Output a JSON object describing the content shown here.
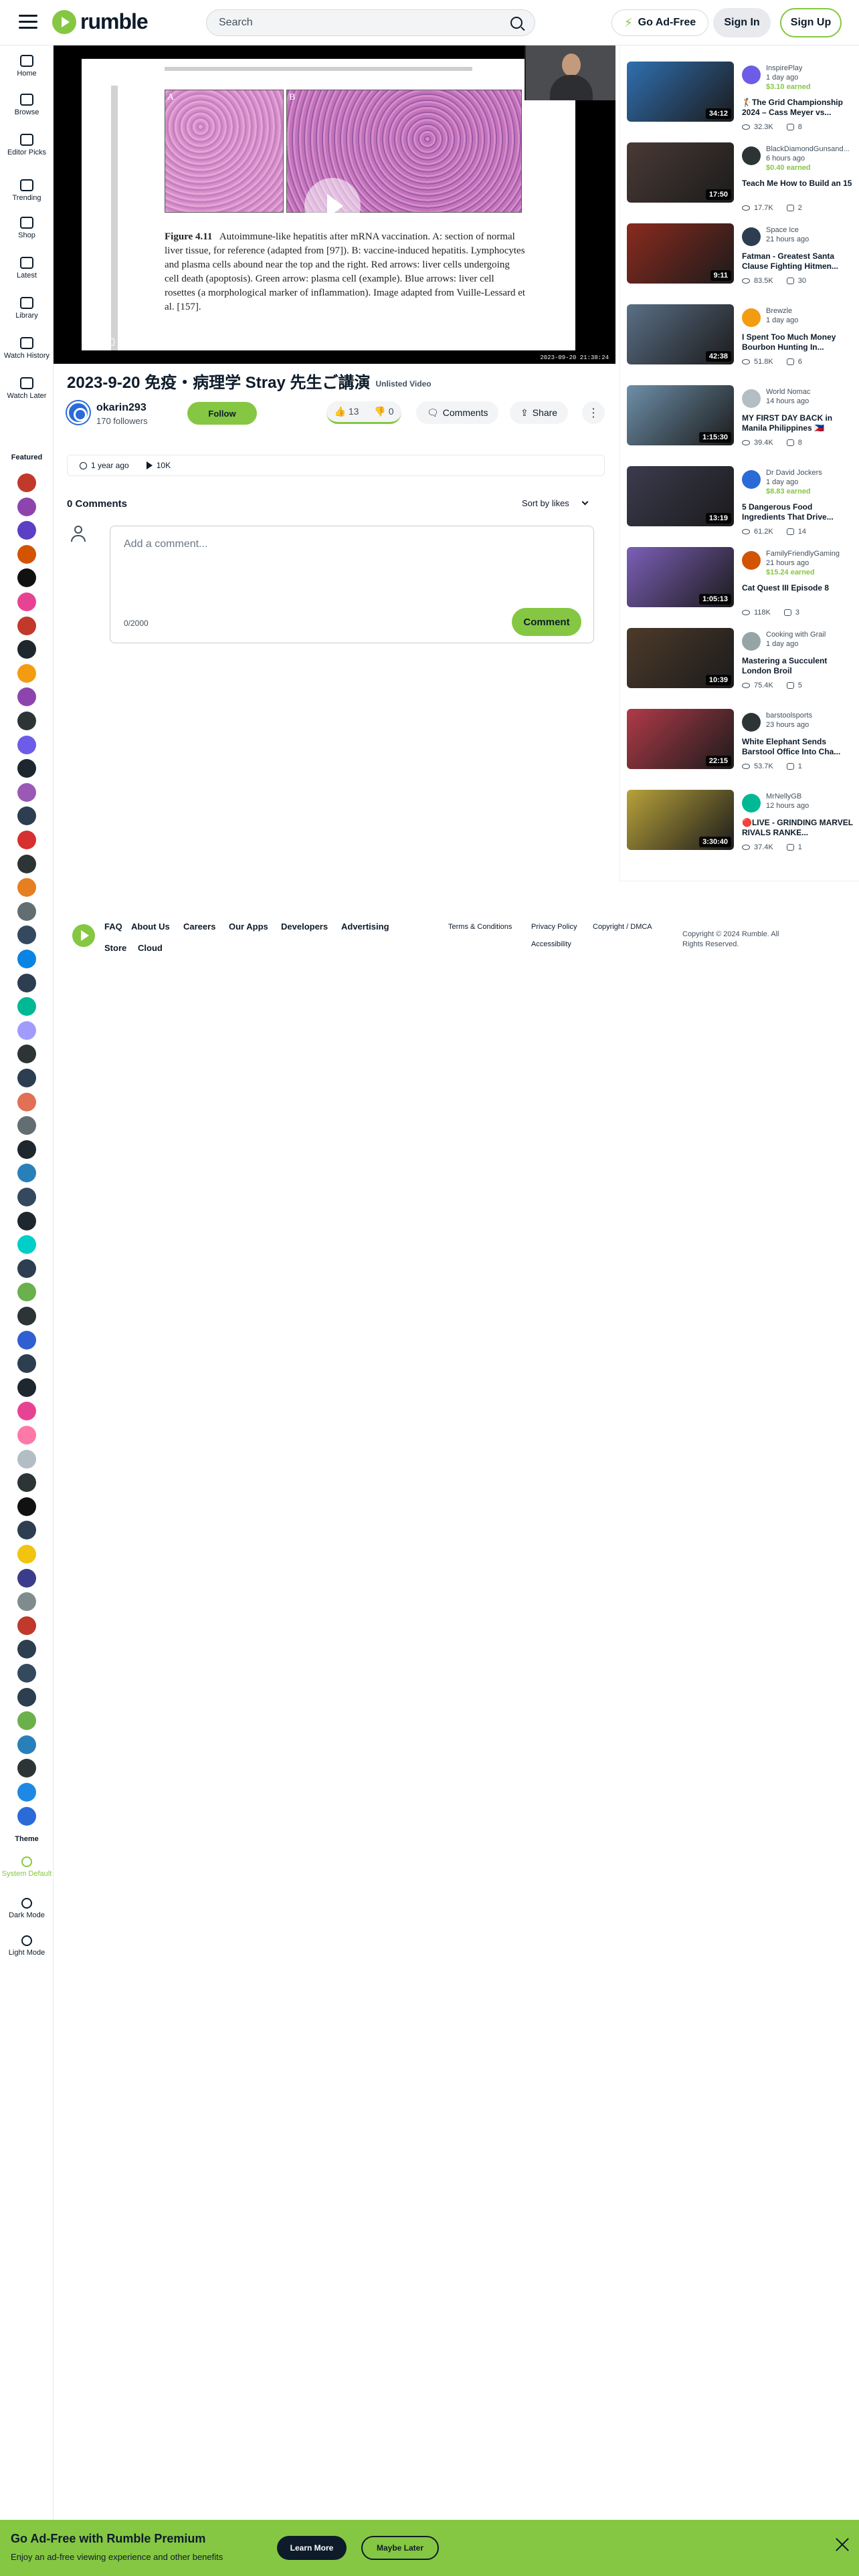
{
  "header": {
    "logo_text": "rumble",
    "search_placeholder": "Search",
    "adfree_label": "Go Ad-Free",
    "signin_label": "Sign In",
    "signup_label": "Sign Up"
  },
  "sidebar": {
    "nav": [
      {
        "label": "Home",
        "icon": "home-icon"
      },
      {
        "label": "Browse",
        "icon": "browse-icon"
      },
      {
        "label": "Editor Picks",
        "icon": "trophy-icon"
      },
      {
        "label": "Trending",
        "icon": "trending-icon"
      },
      {
        "label": "Shop",
        "icon": "shop-icon"
      },
      {
        "label": "Latest",
        "icon": "clock-icon"
      },
      {
        "label": "Library",
        "icon": "library-icon"
      },
      {
        "label": "Watch History",
        "icon": "history-icon"
      },
      {
        "label": "Watch Later",
        "icon": "watch-later-icon"
      }
    ],
    "featured_label": "Featured",
    "featured_colors": [
      "#c0392b",
      "#8e44ad",
      "#5b3fc4",
      "#d35400",
      "#111111",
      "#e84393",
      "#c0392b",
      "#1e272e",
      "#f39c12",
      "#8e44ad",
      "#2d3436",
      "#6c5ce7",
      "#1e272e",
      "#9b59b6",
      "#2c3e50",
      "#d63031",
      "#2d3436",
      "#e67e22",
      "#636e72",
      "#34495e",
      "#0984e3",
      "#2c3e50",
      "#00b894",
      "#a29bfe",
      "#2d3436",
      "#2c3e50",
      "#e17055",
      "#636e72",
      "#1e272e",
      "#2980b9",
      "#34495e",
      "#1e272e",
      "#00cec9",
      "#2c3e50",
      "#6ab04c",
      "#2d3436",
      "#2f5fd0",
      "#2c3e50",
      "#1e272e",
      "#e84393",
      "#fd79a8",
      "#b2bec3",
      "#2d3436",
      "#111111",
      "#2c3e50",
      "#f1c40f",
      "#3c3c8c",
      "#7f8c8d",
      "#c0392b",
      "#2c3e50",
      "#34495e",
      "#2c3e50",
      "#6ab04c",
      "#2980b9",
      "#2d3436",
      "#1e88e5",
      "#2a6bd8"
    ],
    "theme_label": "Theme",
    "theme_options": [
      {
        "label": "System Default",
        "icon": "sun-icon"
      },
      {
        "label": "Dark Mode",
        "icon": "moon-icon"
      },
      {
        "label": "Light Mode",
        "icon": "sun-icon"
      }
    ]
  },
  "player": {
    "panel_a": "A",
    "panel_b": "B",
    "figure_label": "Figure 4.11",
    "caption": "Autoimmune-like hepatitis after mRNA vaccination. A: section of normal liver tissue, for reference (adapted from [97]). B: vaccine-induced hepatitis. Lymphocytes and plasma cells abound near the top and the right. Red arrows: liver cells undergoing cell death (apoptosis). Green arrow: plasma cell (example). Blue arrows: liver cell rosettes (a morphological marker of inflammation). Image adapted from Vuille-Lessard et al. [157].",
    "timestamp": "2023-09-20 21:38:24"
  },
  "video": {
    "title": "2023-9-20 免疫・病理学 Stray 先生ご講演",
    "unlisted": "Unlisted Video",
    "channel": "okarin293",
    "followers": "170 followers",
    "follow_label": "Follow",
    "likes": "13",
    "dislikes": "0",
    "comments_label": "Comments",
    "share_label": "Share",
    "ago": "1 year ago",
    "views": "10K"
  },
  "comments": {
    "count_label": "0 Comments",
    "sort_label": "Sort by likes",
    "placeholder": "Add a comment...",
    "char_count": "0/2000",
    "submit_label": "Comment"
  },
  "related": [
    {
      "channel": "InspirePlay",
      "ago": "1 day ago",
      "earned": "$3.10 earned",
      "title": "🏌The Grid Championship 2024 – Cass Meyer vs...",
      "duration": "34:12",
      "views": "32.3K",
      "comments": "8",
      "thumb": "#2f6fb0",
      "avatar": "#6c5ce7"
    },
    {
      "channel": "BlackDiamondGunsand...",
      "ago": "6 hours ago",
      "earned": "$0.40 earned",
      "title": "Teach Me How to Build an 15",
      "duration": "17:50",
      "views": "17.7K",
      "comments": "2",
      "thumb": "#4a3a35",
      "avatar": "#2d3436"
    },
    {
      "channel": "Space Ice",
      "ago": "21 hours ago",
      "earned": "",
      "title": "Fatman - Greatest Santa Clause Fighting Hitmen...",
      "duration": "9:11",
      "views": "83.5K",
      "comments": "30",
      "thumb": "#8b2a1e",
      "avatar": "#2c3e50"
    },
    {
      "channel": "Brewzle",
      "ago": "1 day ago",
      "earned": "",
      "title": "I Spent Too Much Money Bourbon Hunting In...",
      "duration": "42:38",
      "views": "51.8K",
      "comments": "6",
      "thumb": "#5a6f86",
      "avatar": "#f39c12"
    },
    {
      "channel": "World Nomac",
      "ago": "14 hours ago",
      "earned": "",
      "title": "MY FIRST DAY BACK in Manila Philippines 🇵🇭",
      "duration": "1:15:30",
      "views": "39.4K",
      "comments": "8",
      "thumb": "#6d8fa8",
      "avatar": "#b2bec3"
    },
    {
      "channel": "Dr David Jockers",
      "ago": "1 day ago",
      "earned": "$8.83 earned",
      "title": "5 Dangerous Food Ingredients That Drive...",
      "duration": "13:19",
      "views": "61.2K",
      "comments": "14",
      "thumb": "#3b3b4f",
      "avatar": "#2a6bd8"
    },
    {
      "channel": "FamilyFriendlyGaming",
      "ago": "21 hours ago",
      "earned": "$15.24 earned",
      "title": "Cat Quest III Episode 8",
      "duration": "1:05:13",
      "views": "118K",
      "comments": "3",
      "thumb": "#7c5fb8",
      "avatar": "#d35400"
    },
    {
      "channel": "Cooking with Grail",
      "ago": "1 day ago",
      "earned": "",
      "title": "Mastering a Succulent London Broil",
      "duration": "10:39",
      "views": "75.4K",
      "comments": "5",
      "thumb": "#4d3a2a",
      "avatar": "#95a5a6"
    },
    {
      "channel": "barstoolsports",
      "ago": "23 hours ago",
      "earned": "",
      "title": "White Elephant Sends Barstool Office Into Cha...",
      "duration": "22:15",
      "views": "53.7K",
      "comments": "1",
      "thumb": "#b03a48",
      "avatar": "#2d3436"
    },
    {
      "channel": "MrNellyGB",
      "ago": "12 hours ago",
      "earned": "",
      "title": "🔴LIVE - GRINDING MARVEL RIVALS RANKE...",
      "duration": "3:30:40",
      "views": "37.4K",
      "comments": "1",
      "thumb": "#b8a23a",
      "avatar": "#00b894"
    }
  ],
  "footer": {
    "links": [
      "FAQ",
      "About Us",
      "Careers",
      "Our Apps",
      "Developers",
      "Advertising",
      "Store",
      "Cloud"
    ],
    "legal": [
      "Terms & Conditions",
      "Privacy Policy",
      "Copyright / DMCA",
      "Accessibility"
    ],
    "copyright": "Copyright © 2024 Rumble. All Rights Reserved."
  },
  "banner": {
    "title": "Go Ad-Free with Rumble Premium",
    "subtitle": "Enjoy an ad-free viewing experience and other benefits",
    "learn_label": "Learn More",
    "later_label": "Maybe Later"
  },
  "colors": {
    "brand": "#85c742",
    "text": "#0d1b2a"
  }
}
